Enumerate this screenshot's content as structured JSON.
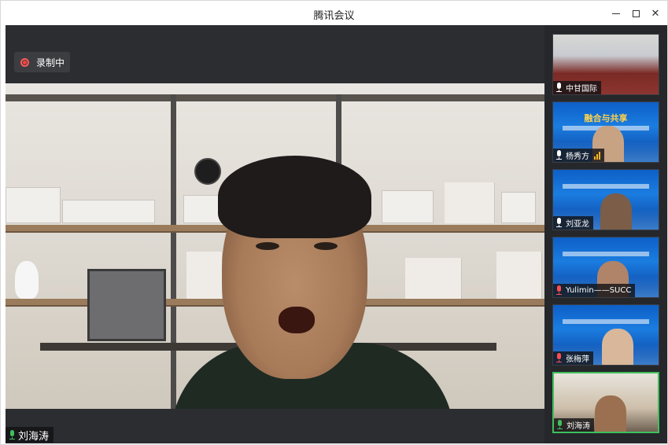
{
  "window": {
    "title": "腾讯会议",
    "minimize_label": "minimize",
    "maximize_label": "maximize",
    "close_label": "close"
  },
  "main_video": {
    "recording_label": "录制中",
    "speaker_name": "刘海涛"
  },
  "participants": [
    {
      "name": "中甘国际",
      "mic": "on"
    },
    {
      "name": "杨秀方",
      "mic": "speaking"
    },
    {
      "name": "刘亚龙",
      "mic": "on"
    },
    {
      "name": "Yulimin——SUCC",
      "mic": "muted"
    },
    {
      "name": "张梅萍",
      "mic": "muted"
    },
    {
      "name": "刘海涛",
      "mic": "on",
      "active": true
    }
  ],
  "slide_banner_text": "融合与共享",
  "colors": {
    "recording": "#ff4040",
    "active_border": "#3fbf5c",
    "mic_on": "#ffffff",
    "mic_muted": "#ff4d4f",
    "speaking_signal": "#f4b322"
  },
  "icons": [
    "record-icon",
    "mic-icon",
    "mic-muted-icon",
    "signal-icon",
    "minimize-icon",
    "maximize-icon",
    "close-icon"
  ]
}
